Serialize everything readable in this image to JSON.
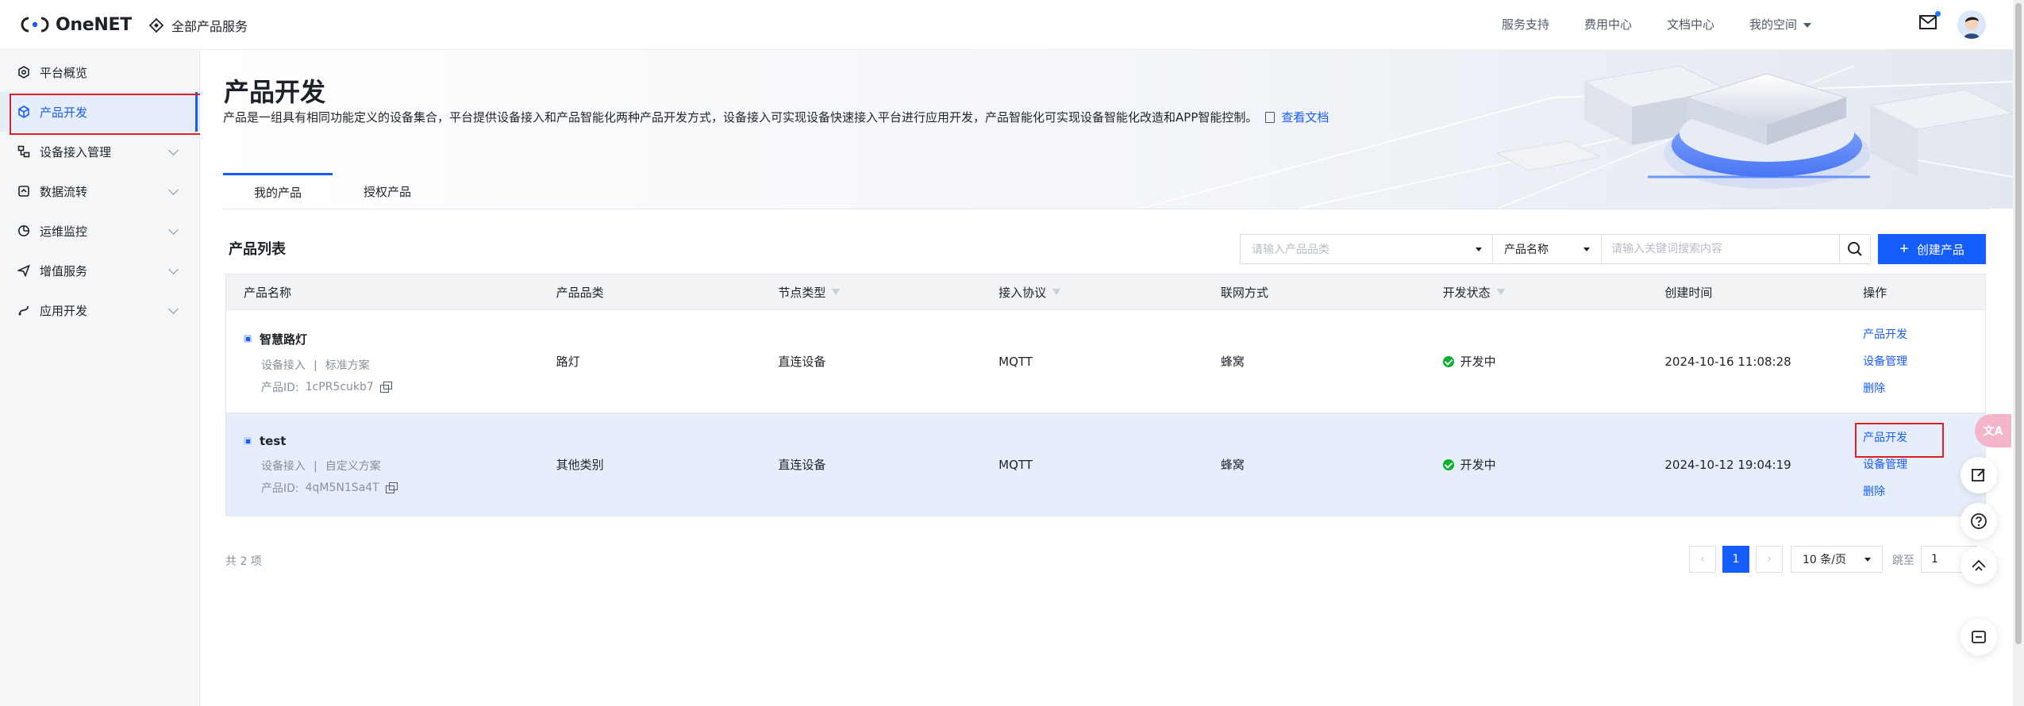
{
  "header": {
    "logo_text": "OneNET",
    "all_products": "全部产品服务",
    "nav": [
      "服务支持",
      "费用中心",
      "文档中心",
      "我的空间"
    ]
  },
  "sidebar": {
    "items": [
      {
        "label": "平台概览",
        "icon": "overview-icon"
      },
      {
        "label": "产品开发",
        "icon": "cube-icon"
      },
      {
        "label": "设备接入管理",
        "icon": "device-icon"
      },
      {
        "label": "数据流转",
        "icon": "data-flow-icon"
      },
      {
        "label": "运维监控",
        "icon": "monitor-icon"
      },
      {
        "label": "增值服务",
        "icon": "plane-icon"
      },
      {
        "label": "应用开发",
        "icon": "app-icon"
      }
    ]
  },
  "page": {
    "title": "产品开发",
    "description": "产品是一组具有相同功能定义的设备集合，平台提供设备接入和产品智能化两种产品开发方式，设备接入可实现设备快速接入平台进行应用开发，产品智能化可实现设备智能化改造和APP智能控制。",
    "doc_link": "查看文档",
    "tabs": [
      "我的产品",
      "授权产品"
    ],
    "list_title": "产品列表"
  },
  "filters": {
    "category_placeholder": "请输入产品品类",
    "field_select": "产品名称",
    "keyword_placeholder": "请输入关键词搜索内容",
    "create_label": "创建产品"
  },
  "table": {
    "headers": [
      "产品名称",
      "产品品类",
      "节点类型",
      "接入协议",
      "联网方式",
      "开发状态",
      "创建时间",
      "操作"
    ],
    "rows": [
      {
        "name": "智慧路灯",
        "access": "设备接入",
        "sep": "|",
        "plan": "标准方案",
        "id_label": "产品ID:",
        "id": "1cPR5cukb7",
        "category": "路灯",
        "node": "直连设备",
        "protocol": "MQTT",
        "network": "蜂窝",
        "status": "开发中",
        "created": "2024-10-16 11:08:28",
        "ops": [
          "产品开发",
          "设备管理",
          "删除"
        ]
      },
      {
        "name": "test",
        "access": "设备接入",
        "sep": "|",
        "plan": "自定义方案",
        "id_label": "产品ID:",
        "id": "4qM5N1Sa4T",
        "category": "其他类别",
        "node": "直连设备",
        "protocol": "MQTT",
        "network": "蜂窝",
        "status": "开发中",
        "created": "2024-10-12 19:04:19",
        "ops": [
          "产品开发",
          "设备管理",
          "删除"
        ]
      }
    ]
  },
  "pagination": {
    "total": "共 2 项",
    "prev": "‹",
    "current": "1",
    "next": "›",
    "page_size": "10 条/页",
    "jump_label": "跳至",
    "jump_value": "1"
  },
  "float": {
    "translate_label": "文A"
  },
  "colors": {
    "primary": "#165dff",
    "success": "#00b42a",
    "highlight_row": "#e6eefc",
    "annotation_red": "#e02020"
  }
}
